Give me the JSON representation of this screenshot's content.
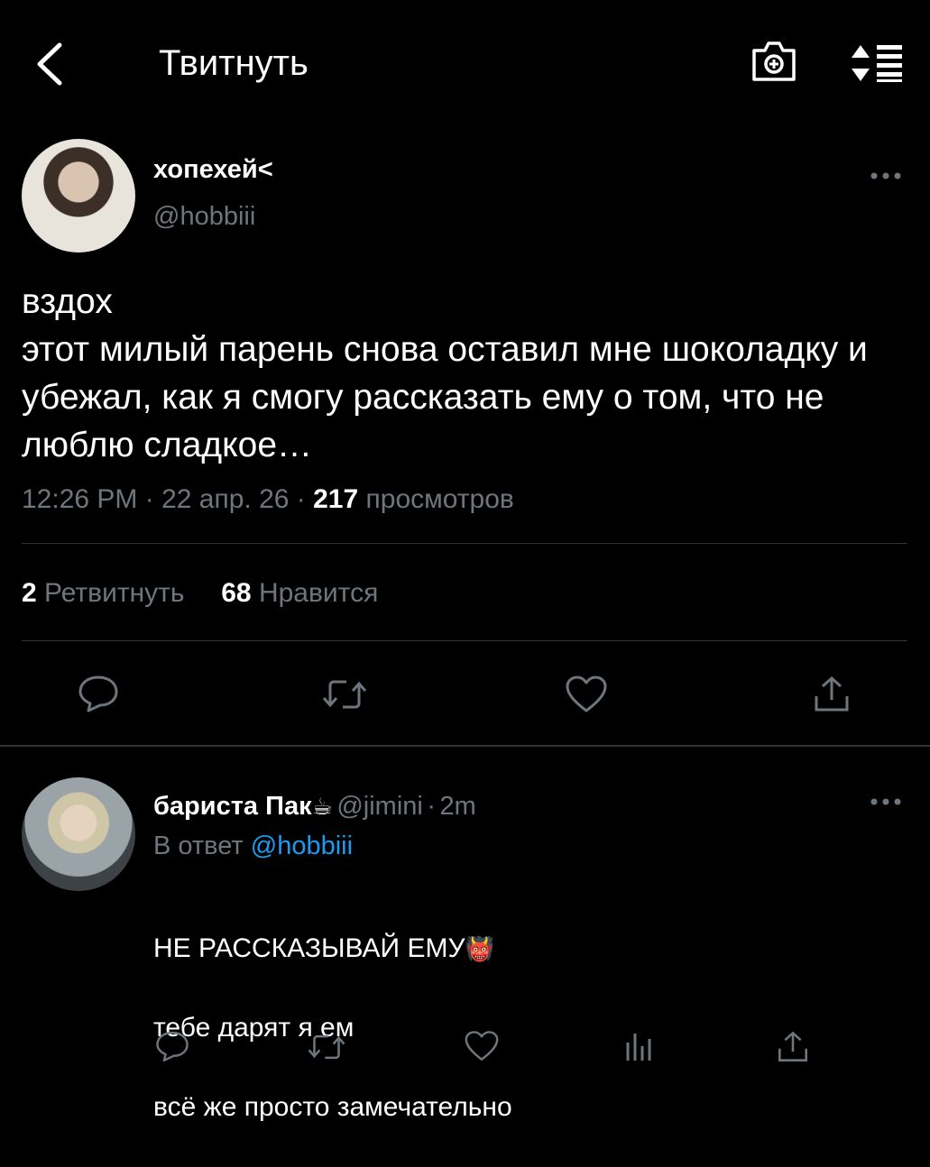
{
  "header": {
    "title": "Твитнуть",
    "back_icon": "chevron-left-icon",
    "camera_icon": "camera-add-icon",
    "sort_icon": "sort-icon"
  },
  "tweet": {
    "author_name": "хопехей<",
    "author_handle": "@hobbiii",
    "text": "вздох\nэтот милый парень снова оставил мне шоколадку и убежал, как я смогу рассказать ему о том, что не люблю сладкое…",
    "time": "12:26 PM",
    "date": "22 апр. 26",
    "views_count": "217",
    "views_label": "просмотров",
    "retweets_count": "2",
    "retweets_label": "Ретвитнуть",
    "likes_count": "68",
    "likes_label": "Нравится"
  },
  "reply": {
    "author_name": "бариста Пак",
    "author_emoji": "☕",
    "author_handle": "@jimini",
    "age": "2m",
    "replying_prefix": "В ответ",
    "replying_to": "@hobbiii",
    "line1": "НЕ РАССКАЗЫВАЙ ЕМУ",
    "line1_emoji": "👹",
    "line2": "тебе дарят я ем",
    "line3": "всё же просто замечательно"
  },
  "colors": {
    "background": "#000000",
    "text": "#ffffff",
    "secondary": "#6e767d",
    "link": "#1d9bf0",
    "divider": "#2f3336"
  }
}
